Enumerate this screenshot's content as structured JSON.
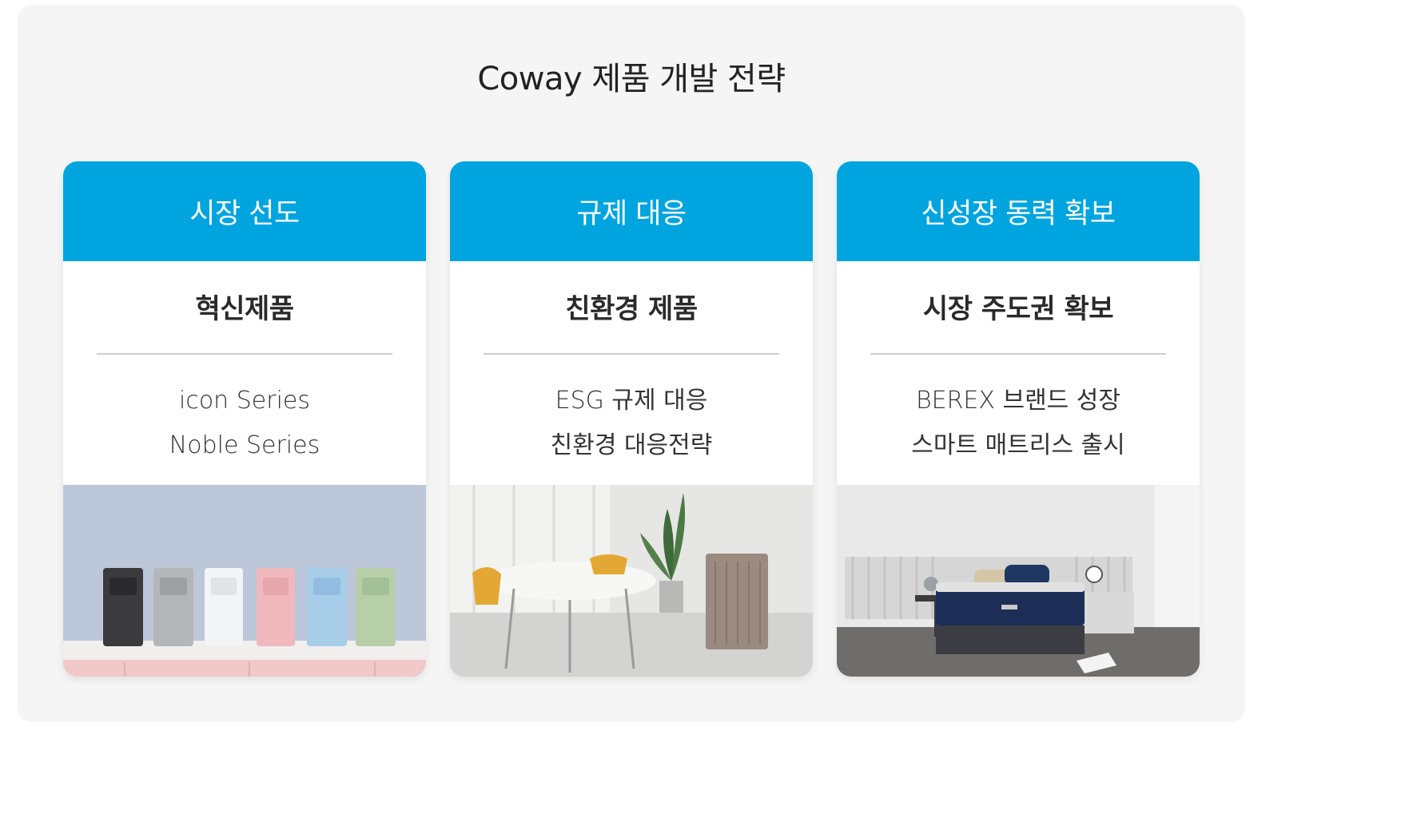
{
  "title": "Coway 제품 개발 전략",
  "colors": {
    "accent": "#00a5e0",
    "panel": "#f5f5f5"
  },
  "cards": [
    {
      "header": "시장 선도",
      "subtitle": "혁신제품",
      "items": [
        "icon Series",
        "Noble Series"
      ],
      "image": "water-purifier-lineup-photo"
    },
    {
      "header": "규제 대응",
      "subtitle": "친환경 제품",
      "items": [
        "ESG 규제 대응",
        "친환경 대응전략"
      ],
      "image": "air-purifier-dining-room-photo"
    },
    {
      "header": "신성장 동력 확보",
      "subtitle": "시장 주도권 확보",
      "items": [
        "BEREX 브랜드 성장",
        "스마트 매트리스 출시"
      ],
      "image": "mattress-bedroom-photo"
    }
  ]
}
